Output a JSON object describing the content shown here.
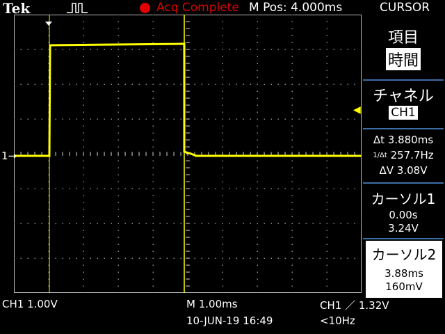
{
  "header": {
    "brand": "Tek",
    "acq_status": "Acq Complete",
    "m_pos": "M Pos: 4.000ms",
    "menu_title": "CURSOR"
  },
  "side_menu": {
    "item_label": "項目",
    "item_value": "時間",
    "channel_label": "チャネル",
    "channel_value": "CH1",
    "delta_t": "Δt 3.880ms",
    "inv_delta_t": "257.7Hz",
    "delta_v": "ΔV 3.08V",
    "cursor1_label": "カーソル1",
    "cursor1_time": "0.00s",
    "cursor1_volt": "3.24V",
    "cursor2_label": "カーソル2",
    "cursor2_time": "3.88ms",
    "cursor2_volt": "160mV"
  },
  "footer": {
    "ch1_scale": "CH1  1.00V",
    "timebase": "M 1.00ms",
    "trigger": "CH1 ／ 1.32V",
    "datetime": "10-JUN-19 16:49",
    "freq": "<10Hz"
  },
  "channel_marker": "1→",
  "colors": {
    "trace": "#ffff00",
    "status_red": "#e00000",
    "separator": "#3c6ea6"
  }
}
